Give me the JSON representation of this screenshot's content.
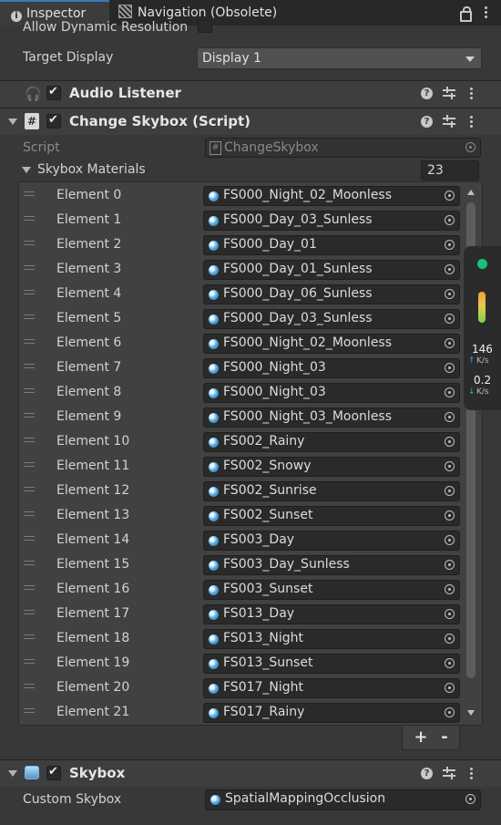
{
  "tabs": [
    {
      "label": "Inspector",
      "icon": "info-icon",
      "active": true
    },
    {
      "label": "Navigation (Obsolete)",
      "icon": "navigation-icon",
      "active": false
    }
  ],
  "camera": {
    "allow_dynamic_resolution_label": "Allow Dynamic Resolution",
    "target_display_label": "Target Display",
    "target_display_value": "Display 1"
  },
  "audio_listener": {
    "title": "Audio Listener",
    "icon": "headphones-icon",
    "enabled": true
  },
  "change_skybox": {
    "title": "Change Skybox (Script)",
    "icon": "script-icon",
    "enabled": true,
    "script_label": "Script",
    "script_value": "ChangeSkybox",
    "materials_label": "Skybox Materials",
    "materials_count": "23",
    "elements": [
      {
        "label": "Element 0",
        "value": "FS000_Night_02_Moonless"
      },
      {
        "label": "Element 1",
        "value": "FS000_Day_03_Sunless"
      },
      {
        "label": "Element 2",
        "value": "FS000_Day_01"
      },
      {
        "label": "Element 3",
        "value": "FS000_Day_01_Sunless"
      },
      {
        "label": "Element 4",
        "value": "FS000_Day_06_Sunless"
      },
      {
        "label": "Element 5",
        "value": "FS000_Day_03_Sunless"
      },
      {
        "label": "Element 6",
        "value": "FS000_Night_02_Moonless"
      },
      {
        "label": "Element 7",
        "value": "FS000_Night_03"
      },
      {
        "label": "Element 8",
        "value": "FS000_Night_03"
      },
      {
        "label": "Element 9",
        "value": "FS000_Night_03_Moonless"
      },
      {
        "label": "Element 10",
        "value": "FS002_Rainy"
      },
      {
        "label": "Element 11",
        "value": "FS002_Snowy"
      },
      {
        "label": "Element 12",
        "value": "FS002_Sunrise"
      },
      {
        "label": "Element 13",
        "value": "FS002_Sunset"
      },
      {
        "label": "Element 14",
        "value": "FS003_Day"
      },
      {
        "label": "Element 15",
        "value": "FS003_Day_Sunless"
      },
      {
        "label": "Element 16",
        "value": "FS003_Sunset"
      },
      {
        "label": "Element 17",
        "value": "FS013_Day"
      },
      {
        "label": "Element 18",
        "value": "FS013_Night"
      },
      {
        "label": "Element 19",
        "value": "FS013_Sunset"
      },
      {
        "label": "Element 20",
        "value": "FS017_Night"
      },
      {
        "label": "Element 21",
        "value": "FS017_Rainy"
      }
    ],
    "add_label": "+",
    "remove_label": "-"
  },
  "skybox": {
    "title": "Skybox",
    "icon": "skybox-icon",
    "enabled": true,
    "custom_label": "Custom Skybox",
    "custom_value": "SpatialMappingOcclusion"
  },
  "network_widget": {
    "upload_value": "146",
    "upload_unit": "K/s",
    "download_value": "0.2",
    "download_unit": "K/s",
    "status_color": "#17c37b"
  },
  "colors": {
    "accent": "#3a79bb",
    "panel": "#383838",
    "field": "#2a2a2a"
  }
}
